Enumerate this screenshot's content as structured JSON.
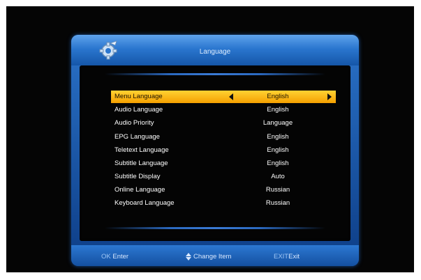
{
  "window": {
    "title": "Language"
  },
  "settings": [
    {
      "label": "Menu Language",
      "value": "English",
      "selected": true
    },
    {
      "label": "Audio Language",
      "value": "English"
    },
    {
      "label": "Audio Priority",
      "value": "Language"
    },
    {
      "label": "EPG Language",
      "value": "English"
    },
    {
      "label": "Teletext Language",
      "value": "English"
    },
    {
      "label": "Subtitle Language",
      "value": "English"
    },
    {
      "label": "Subtitle Display",
      "value": "Auto"
    },
    {
      "label": "Online Language",
      "value": "Russian"
    },
    {
      "label": "Keyboard Language",
      "value": "Russian"
    }
  ],
  "footer": {
    "ok_key": "OK",
    "ok_label": "Enter",
    "change_label": "Change Item",
    "exit_key": "EXIT",
    "exit_label": "Exit"
  },
  "colors": {
    "panel_blue": "#2a72c8",
    "highlight": "#f5a000",
    "screen_bg": "#050505"
  },
  "icons": {
    "logo": "gear-wrench-icon",
    "left": "arrow-left-icon",
    "right": "arrow-right-icon",
    "updown": "up-down-arrow-icon"
  }
}
